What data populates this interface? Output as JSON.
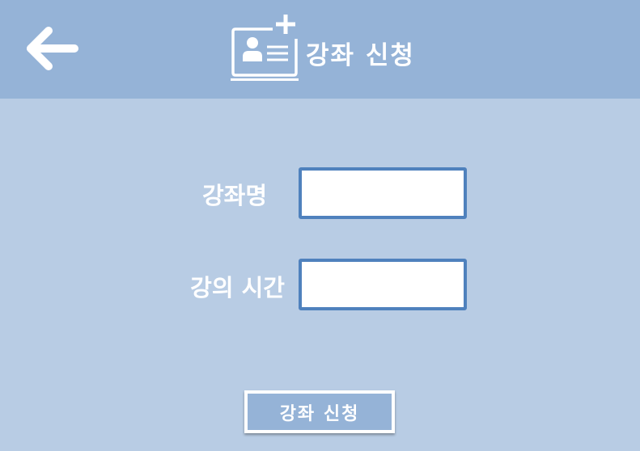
{
  "header": {
    "back_icon": "arrow-left-icon",
    "title_icon": "user-card-plus-icon",
    "title": "강좌 신청"
  },
  "form": {
    "course_name_label": "강좌명",
    "course_name_value": "",
    "lecture_time_label": "강의 시간",
    "lecture_time_value": ""
  },
  "actions": {
    "submit_label": "강좌 신청"
  },
  "colors": {
    "background": "#b8cce4",
    "header": "#95b3d7",
    "field_border": "#4f81bd",
    "text": "#ffffff"
  }
}
